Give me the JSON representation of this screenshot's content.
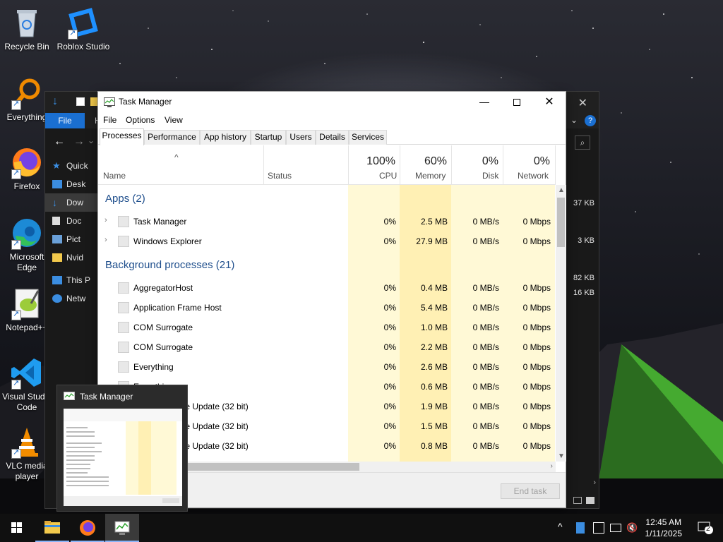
{
  "desktop": {
    "icons": [
      {
        "label": "Recycle Bin"
      },
      {
        "label": "Roblox Studio"
      },
      {
        "label": "Everything"
      },
      {
        "label": "Firefox"
      },
      {
        "label": "Microsoft Edge"
      },
      {
        "label": "Notepad++"
      },
      {
        "label": "Visual Studio Code"
      },
      {
        "label": "VLC media player"
      }
    ]
  },
  "explorer": {
    "file_tab": "File",
    "ribbon_partial": "H",
    "sidebar": [
      "Quick",
      "Desk",
      "Dow",
      "Doc",
      "Pict",
      "Nvid",
      "This P",
      "Netw"
    ],
    "sizes": [
      "37 KB",
      "3 KB",
      "82 KB",
      "16 KB"
    ]
  },
  "taskmanager": {
    "title": "Task Manager",
    "menu": [
      "File",
      "Options",
      "View"
    ],
    "tabs": [
      "Processes",
      "Performance",
      "App history",
      "Startup",
      "Users",
      "Details",
      "Services"
    ],
    "columns": {
      "name": "Name",
      "status": "Status",
      "cpu": {
        "pct": "100%",
        "label": "CPU"
      },
      "memory": {
        "pct": "60%",
        "label": "Memory"
      },
      "disk": {
        "pct": "0%",
        "label": "Disk"
      },
      "network": {
        "pct": "0%",
        "label": "Network"
      }
    },
    "groups": {
      "apps": "Apps (2)",
      "background": "Background processes (21)"
    },
    "apps": [
      {
        "name": "Task Manager",
        "cpu": "0%",
        "mem": "2.5 MB",
        "disk": "0 MB/s",
        "net": "0 Mbps"
      },
      {
        "name": "Windows Explorer",
        "cpu": "0%",
        "mem": "27.9 MB",
        "disk": "0 MB/s",
        "net": "0 Mbps"
      }
    ],
    "background": [
      {
        "name": "AggregatorHost",
        "cpu": "0%",
        "mem": "0.4 MB",
        "disk": "0 MB/s",
        "net": "0 Mbps"
      },
      {
        "name": "Application Frame Host",
        "cpu": "0%",
        "mem": "5.4 MB",
        "disk": "0 MB/s",
        "net": "0 Mbps"
      },
      {
        "name": "COM Surrogate",
        "cpu": "0%",
        "mem": "1.0 MB",
        "disk": "0 MB/s",
        "net": "0 Mbps"
      },
      {
        "name": "COM Surrogate",
        "cpu": "0%",
        "mem": "2.2 MB",
        "disk": "0 MB/s",
        "net": "0 Mbps"
      },
      {
        "name": "Everything",
        "cpu": "0%",
        "mem": "2.6 MB",
        "disk": "0 MB/s",
        "net": "0 Mbps"
      },
      {
        "name": "Everything",
        "cpu": "0%",
        "mem": "0.6 MB",
        "disk": "0 MB/s",
        "net": "0 Mbps"
      },
      {
        "name": "Microsoft Edge Update (32 bit)",
        "cpu": "0%",
        "mem": "1.9 MB",
        "disk": "0 MB/s",
        "net": "0 Mbps"
      },
      {
        "name": "Microsoft Edge Update (32 bit)",
        "cpu": "0%",
        "mem": "1.5 MB",
        "disk": "0 MB/s",
        "net": "0 Mbps"
      },
      {
        "name": "Microsoft Edge Update (32 bit)",
        "cpu": "0%",
        "mem": "0.8 MB",
        "disk": "0 MB/s",
        "net": "0 Mbps"
      }
    ],
    "end_task": "End task"
  },
  "preview": {
    "title": "Task Manager"
  },
  "taskbar": {
    "time": "12:45 AM",
    "date": "1/11/2025",
    "notification_count": "2"
  }
}
